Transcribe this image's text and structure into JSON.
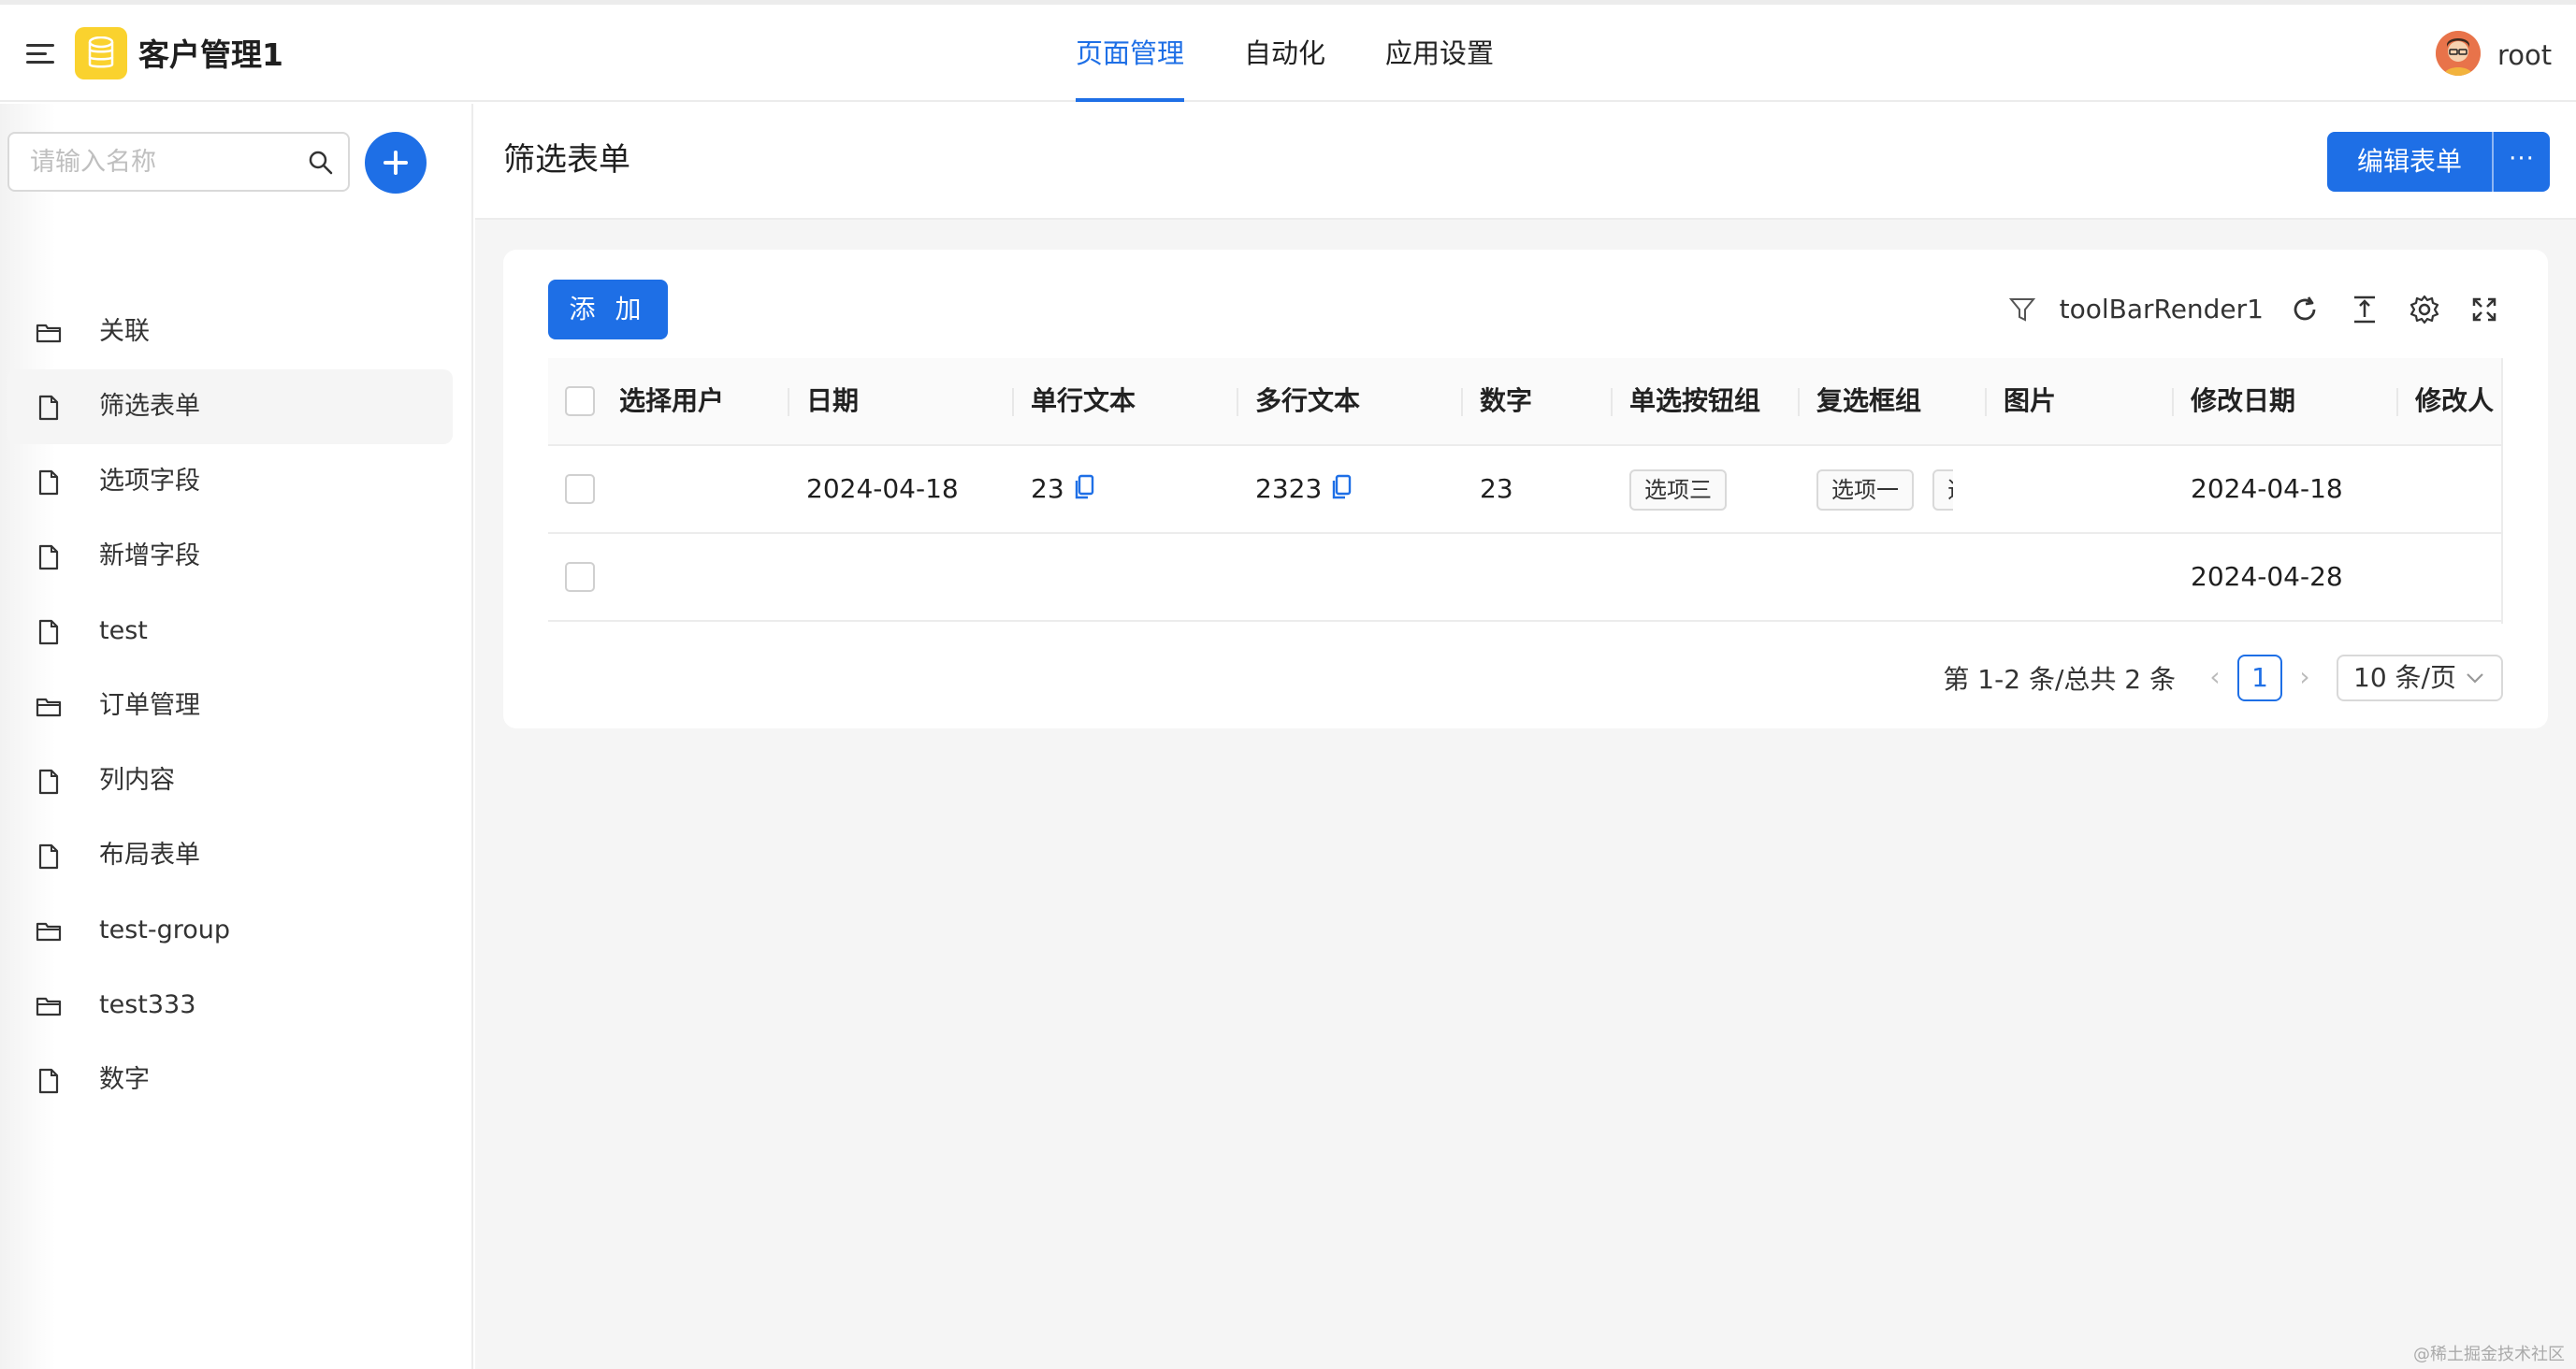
{
  "app": {
    "title": "客户管理1"
  },
  "nav": {
    "tabs": [
      {
        "label": "页面管理",
        "active": true
      },
      {
        "label": "自动化",
        "active": false
      },
      {
        "label": "应用设置",
        "active": false
      }
    ]
  },
  "user": {
    "name": "root"
  },
  "sidebar": {
    "search_placeholder": "请输入名称",
    "items": [
      {
        "label": "关联",
        "icon": "folder-icon"
      },
      {
        "label": "筛选表单",
        "icon": "file-icon",
        "selected": true
      },
      {
        "label": "选项字段",
        "icon": "file-icon"
      },
      {
        "label": "新增字段",
        "icon": "file-icon"
      },
      {
        "label": "test",
        "icon": "file-icon"
      },
      {
        "label": "订单管理",
        "icon": "folder-icon"
      },
      {
        "label": "列内容",
        "icon": "file-icon"
      },
      {
        "label": "布局表单",
        "icon": "file-icon"
      },
      {
        "label": "test-group",
        "icon": "folder-icon"
      },
      {
        "label": "test333",
        "icon": "folder-icon"
      },
      {
        "label": "数字",
        "icon": "file-icon"
      }
    ]
  },
  "page": {
    "title": "筛选表单",
    "edit_label": "编辑表单",
    "more_label": "···"
  },
  "toolbar": {
    "add_label": "添 加",
    "render_label": "toolBarRender1"
  },
  "table": {
    "columns": [
      "选择用户",
      "日期",
      "单行文本",
      "多行文本",
      "数字",
      "单选按钮组",
      "复选框组",
      "图片",
      "修改日期",
      "修改人"
    ],
    "rows": [
      {
        "user": "",
        "date": "2024-04-18",
        "single": "23",
        "multi": "2323",
        "number": "23",
        "radio": "选项三",
        "checkbox": [
          "选项一",
          "选"
        ],
        "image": "",
        "modified": "2024-04-18",
        "modifier": ""
      },
      {
        "user": "",
        "date": "",
        "single": "",
        "multi": "",
        "number": "",
        "radio": "",
        "checkbox": [],
        "image": "",
        "modified": "2024-04-28",
        "modifier": ""
      }
    ]
  },
  "pagination": {
    "total_text": "第 1-2 条/总共 2 条",
    "current_page": "1",
    "page_size": "10 条/页"
  },
  "watermark": "@稀土掘金技术社区",
  "colors": {
    "accent": "#1e6fe6",
    "app_icon": "#fad22e"
  }
}
